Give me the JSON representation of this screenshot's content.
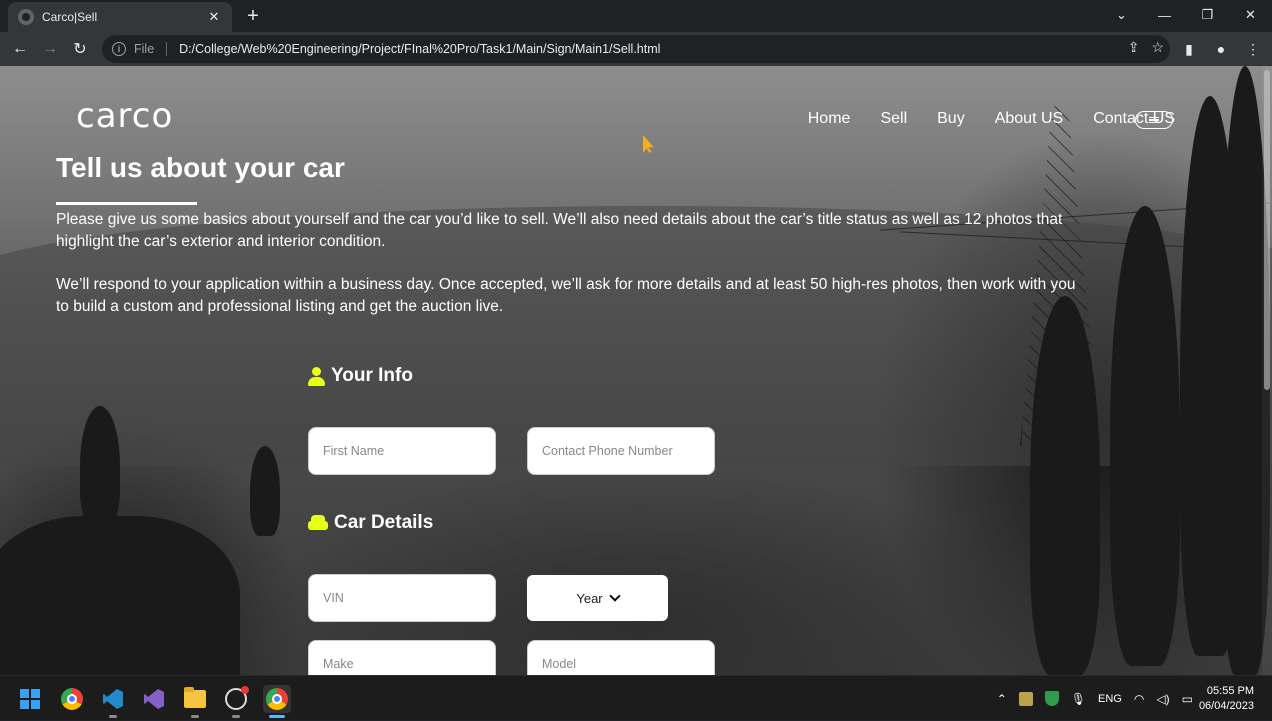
{
  "browser": {
    "tab_title": "Carco|Sell",
    "url_scheme": "File",
    "url": "D:/College/Web%20Engineering/Project/FInal%20Pro/Task1/Main/Sign/Main1/Sell.html"
  },
  "site": {
    "logo": "carco",
    "nav": [
      "Home",
      "Sell",
      "Buy",
      "About US",
      "Contact US"
    ]
  },
  "page": {
    "heading": "Tell us about your car",
    "para1": "Please give us some basics about yourself and the car you’d like to sell. We’ll also need details about the car’s title status as well as 12 photos that highlight the car’s exterior and interior condition.",
    "para2": "We’ll respond to your application within a business day. Once accepted, we’ll ask for more details and at least 50 high-res photos, then work with you to build a custom and professional listing and get the auction live."
  },
  "your_info": {
    "title": "Your Info",
    "first_name_placeholder": "First Name",
    "phone_placeholder": "Contact Phone Number"
  },
  "car_details": {
    "title": "Car Details",
    "vin_placeholder": "VIN",
    "year_label": "Year",
    "make_placeholder": "Make",
    "model_placeholder": "Model"
  },
  "taskbar": {
    "lang": "ENG",
    "time": "05:55 PM",
    "date": "06/04/2023"
  },
  "colors": {
    "accent_icon": "#e8ff1a",
    "cursor": "#f2b01e"
  }
}
